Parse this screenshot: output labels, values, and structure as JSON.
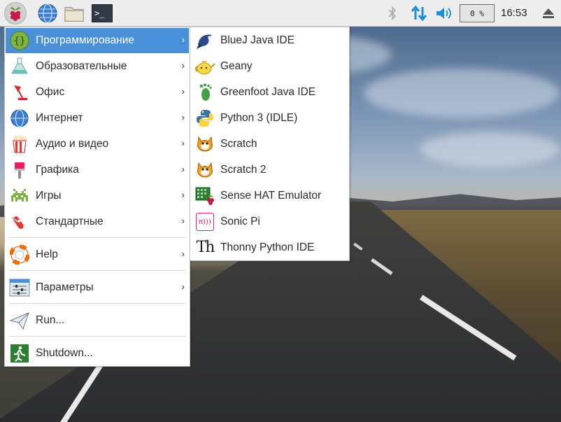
{
  "taskbar": {
    "launchers": [
      {
        "name": "raspberry-menu",
        "icon": "raspberry-icon"
      },
      {
        "name": "web-browser",
        "icon": "globe-icon"
      },
      {
        "name": "file-manager",
        "icon": "folder-icon"
      },
      {
        "name": "terminal",
        "icon": "terminal-icon",
        "glyph": ">_"
      }
    ],
    "tray": {
      "bluetooth_icon": "bluetooth-icon",
      "network_icon": "network-updown-icon",
      "volume_icon": "speaker-icon",
      "cpu_usage": "0 %",
      "clock": "16:53",
      "eject_icon": "eject-icon"
    }
  },
  "main_menu": {
    "items": [
      {
        "label": "Программирование",
        "icon": "programming-icon",
        "has_submenu": true,
        "active": true
      },
      {
        "label": "Образовательные",
        "icon": "education-flask-icon",
        "has_submenu": true
      },
      {
        "label": "Офис",
        "icon": "office-lamp-icon",
        "has_submenu": true
      },
      {
        "label": "Интернет",
        "icon": "globe-icon",
        "has_submenu": true
      },
      {
        "label": "Аудио и видео",
        "icon": "popcorn-icon",
        "has_submenu": true
      },
      {
        "label": "Графика",
        "icon": "paintbrush-icon",
        "has_submenu": true
      },
      {
        "label": "Игры",
        "icon": "space-invader-icon",
        "has_submenu": true
      },
      {
        "label": "Стандартные",
        "icon": "swiss-knife-icon",
        "has_submenu": true
      },
      {
        "label": "Help",
        "icon": "lifebuoy-icon",
        "has_submenu": true
      },
      {
        "label": "Параметры",
        "icon": "preferences-sliders-icon",
        "has_submenu": true
      },
      {
        "label": "Run...",
        "icon": "paper-plane-icon",
        "has_submenu": false
      },
      {
        "label": "Shutdown...",
        "icon": "exit-running-man-icon",
        "has_submenu": false
      }
    ],
    "arrow_glyph": "›"
  },
  "programming_submenu": {
    "items": [
      {
        "label": "BlueJ Java IDE",
        "icon": "bluej-bird-icon"
      },
      {
        "label": "Geany",
        "icon": "geany-teapot-icon"
      },
      {
        "label": "Greenfoot Java IDE",
        "icon": "greenfoot-footprint-icon"
      },
      {
        "label": "Python 3 (IDLE)",
        "icon": "python-icon"
      },
      {
        "label": "Scratch",
        "icon": "scratch-cat-icon"
      },
      {
        "label": "Scratch 2",
        "icon": "scratch2-cat-icon"
      },
      {
        "label": "Sense HAT Emulator",
        "icon": "sense-hat-icon"
      },
      {
        "label": "Sonic Pi",
        "icon": "sonic-pi-icon",
        "glyph": "π)))"
      },
      {
        "label": "Thonny Python IDE",
        "icon": "thonny-icon",
        "glyph": "Th"
      }
    ]
  },
  "colors": {
    "menu_highlight": "#4a90d9",
    "taskbar_bg": "#ededed",
    "accent_blue": "#1a8fd6"
  }
}
